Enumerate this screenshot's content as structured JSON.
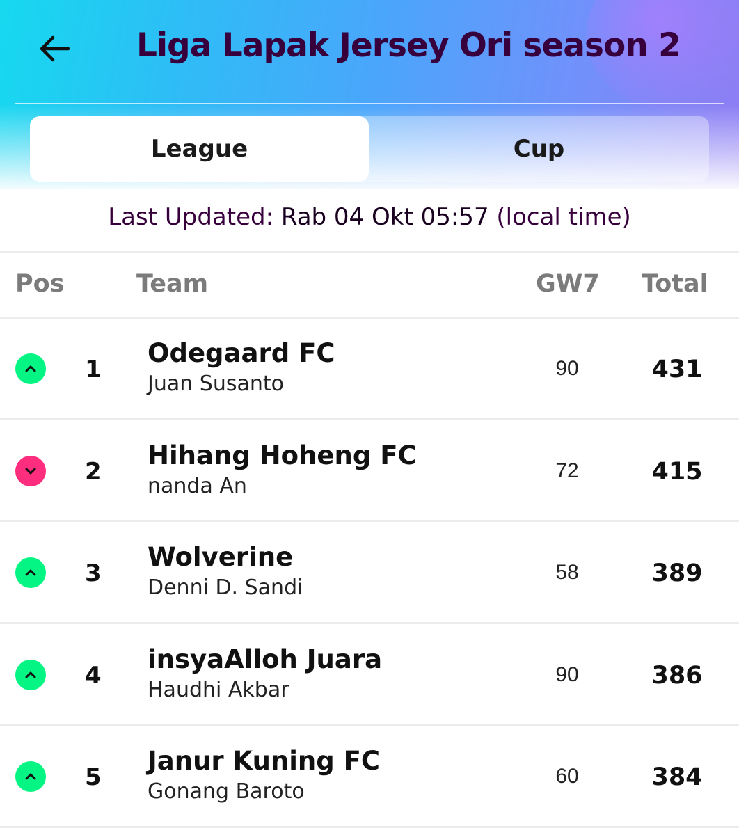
{
  "header": {
    "title": "Liga Lapak Jersey Ori season 2",
    "back_icon": "arrow-left-icon"
  },
  "tabs": [
    {
      "label": "League",
      "active": true
    },
    {
      "label": "Cup",
      "active": false
    }
  ],
  "updated": {
    "prefix": "Last Updated: ",
    "stamp": "Rab 04 Okt 05:57",
    "suffix": " (local time)"
  },
  "columns": {
    "pos": "Pos",
    "team": "Team",
    "gw": "GW7",
    "total": "Total"
  },
  "colors": {
    "up": "#05f584",
    "down": "#ff2d7d",
    "title": "#37003c"
  },
  "rows": [
    {
      "movement": "up",
      "pos": "1",
      "team": "Odegaard FC",
      "manager": "Juan Susanto",
      "gw": "90",
      "total": "431"
    },
    {
      "movement": "down",
      "pos": "2",
      "team": "Hihang Hoheng FC",
      "manager": "nanda An",
      "gw": "72",
      "total": "415"
    },
    {
      "movement": "up",
      "pos": "3",
      "team": "Wolverine",
      "manager": "Denni D. Sandi",
      "gw": "58",
      "total": "389"
    },
    {
      "movement": "up",
      "pos": "4",
      "team": "insyaAlloh Juara",
      "manager": "Haudhi Akbar",
      "gw": "90",
      "total": "386"
    },
    {
      "movement": "up",
      "pos": "5",
      "team": "Janur Kuning FC",
      "manager": "Gonang Baroto",
      "gw": "60",
      "total": "384"
    }
  ]
}
